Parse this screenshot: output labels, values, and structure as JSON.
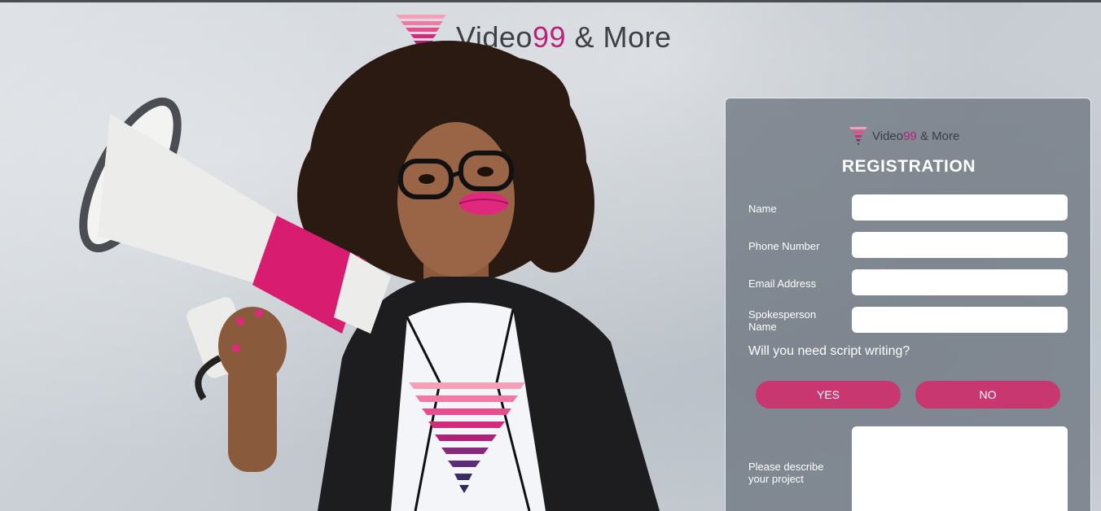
{
  "brand": {
    "name_part1": "Video",
    "name_highlight": "99",
    "name_part2": " & More",
    "accent_color": "#b8227a"
  },
  "registration": {
    "title": "REGISTRATION",
    "fields": {
      "name": {
        "label": "Name",
        "value": ""
      },
      "phone": {
        "label": "Phone Number",
        "value": ""
      },
      "email": {
        "label": "Email Address",
        "value": ""
      },
      "spokesperson": {
        "label": "Spokesperson Name",
        "value": ""
      }
    },
    "question": "Will you need script writing?",
    "yes_label": "YES",
    "no_label": "NO",
    "project_label": "Please describe your project",
    "project_value": "",
    "button_color": "#c8376f"
  },
  "icons": {
    "logo": "funnel-stripes-logo",
    "megaphone": "megaphone-icon",
    "shirt_logo": "funnel-stripes-logo"
  }
}
